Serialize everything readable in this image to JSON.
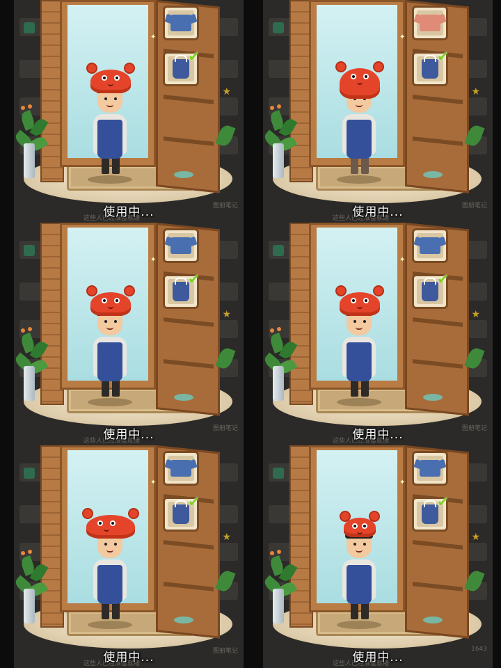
{
  "panels": [
    {
      "status": "使用中...",
      "top_slot_icon": "shirt-icon",
      "top_slot_color": "#4a6fb0",
      "bottom_slot_icon": "apron-icon",
      "selected": "bottom"
    },
    {
      "status": "使用中...",
      "top_slot_icon": "shirt-icon",
      "top_slot_color": "#e08a78",
      "bottom_slot_icon": "apron-icon",
      "selected": "bottom"
    },
    {
      "status": "使用中...",
      "top_slot_icon": "shirt-icon",
      "top_slot_color": "#4a6fb0",
      "bottom_slot_icon": "apron-icon",
      "selected": "bottom"
    },
    {
      "status": "使用中...",
      "top_slot_icon": "shirt-icon",
      "top_slot_color": "#4a6fb0",
      "bottom_slot_icon": "apron-icon",
      "selected": "bottom"
    },
    {
      "status": "使用中...",
      "top_slot_icon": "shirt-icon",
      "top_slot_color": "#4a6fb0",
      "bottom_slot_icon": "apron-icon",
      "selected": "bottom"
    },
    {
      "status": "使用中...",
      "top_slot_icon": "shirt-icon",
      "top_slot_color": "#4a6fb0",
      "bottom_slot_icon": "apron-icon",
      "selected": "bottom"
    }
  ],
  "check_mark": "✔",
  "background_text": {
    "note": "图册笔记",
    "count": "1643",
    "caption": "这些人已经准备就绪"
  },
  "colors": {
    "crab_hat": "#e4452a",
    "apron": "#34509a",
    "check": "#7ed321",
    "mirror": "#a9dde1",
    "wood": "#a76c3a"
  }
}
